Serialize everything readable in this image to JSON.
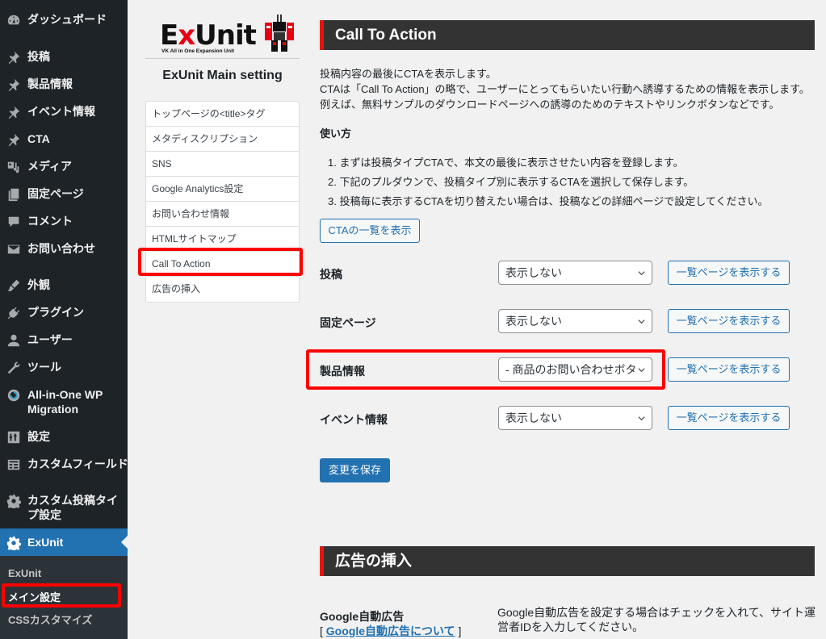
{
  "admin_menu": {
    "items": [
      {
        "label": "ダッシュボード",
        "icon": "dashboard-icon"
      },
      {
        "label": "投稿",
        "icon": "pin-icon"
      },
      {
        "label": "製品情報",
        "icon": "pin-icon"
      },
      {
        "label": "イベント情報",
        "icon": "pin-icon"
      },
      {
        "label": "CTA",
        "icon": "pin-icon"
      },
      {
        "label": "メディア",
        "icon": "media-icon"
      },
      {
        "label": "固定ページ",
        "icon": "page-icon"
      },
      {
        "label": "コメント",
        "icon": "comment-icon"
      },
      {
        "label": "お問い合わせ",
        "icon": "mail-icon"
      },
      {
        "label": "外観",
        "icon": "brush-icon"
      },
      {
        "label": "プラグイン",
        "icon": "plugin-icon"
      },
      {
        "label": "ユーザー",
        "icon": "user-icon"
      },
      {
        "label": "ツール",
        "icon": "wrench-icon"
      },
      {
        "label": "All-in-One WP Migration",
        "icon": "migration-icon"
      },
      {
        "label": "設定",
        "icon": "settings-icon"
      },
      {
        "label": "カスタムフィールド",
        "icon": "custom-field-icon"
      },
      {
        "label": "カスタム投稿タイプ設定",
        "icon": "gear-icon"
      },
      {
        "label": "ExUnit",
        "icon": "gear-icon"
      }
    ],
    "submenu": [
      {
        "label": "ExUnit"
      },
      {
        "label": "メイン設定"
      },
      {
        "label": "CSSカスタマイズ"
      }
    ]
  },
  "exunit_nav": {
    "logo_text": "ExUnit",
    "logo_sub": "VK All in One Expansion Unit",
    "title": "ExUnit Main setting",
    "items": [
      "トップページの<title>タグ",
      "メタディスクリプション",
      "SNS",
      "Google Analytics設定",
      "お問い合わせ情報",
      "HTMLサイトマップ",
      "Call To Action",
      "広告の挿入"
    ]
  },
  "cta": {
    "heading": "Call To Action",
    "intro": [
      "投稿内容の最後にCTAを表示します。",
      "CTAは「Call To Action」の略で、ユーザーにとってもらいたい行動へ誘導するための情報を表示します。",
      "例えば、無料サンプルのダウンロードページへの誘導のためのテキストやリンクボタンなどです。"
    ],
    "howto_title": "使い方",
    "howto_steps": [
      "1. まずは投稿タイプCTAで、本文の最後に表示させたい内容を登録します。",
      "2. 下記のプルダウンで、投稿タイプ別に表示するCTAを選択して保存します。",
      "3. 投稿毎に表示するCTAを切り替えたい場合は、投稿などの詳細ページで設定してください。"
    ],
    "list_button": "CTAの一覧を表示",
    "rows": [
      {
        "label": "投稿",
        "selected": "表示しない",
        "button": "一覧ページを表示する"
      },
      {
        "label": "固定ページ",
        "selected": "表示しない",
        "button": "一覧ページを表示する"
      },
      {
        "label": "製品情報",
        "selected": "- 商品のお問い合わせボタン",
        "button": "一覧ページを表示する"
      },
      {
        "label": "イベント情報",
        "selected": "表示しない",
        "button": "一覧ページを表示する"
      }
    ],
    "save_button": "変更を保存"
  },
  "ads": {
    "heading": "広告の挿入",
    "label": "Google自動広告",
    "link_prefix": "[ ",
    "link_text": "Google自動広告について",
    "link_suffix": " ]",
    "description": "Google自動広告を設定する場合はチェックを入れて、サイト運営者IDを入力してください。"
  },
  "colors": {
    "sidebar_bg": "#1d2327",
    "accent_blue": "#2271b1",
    "section_head_bg": "#333333",
    "section_head_accent": "#e2170c",
    "highlight_box": "#ff0000"
  }
}
